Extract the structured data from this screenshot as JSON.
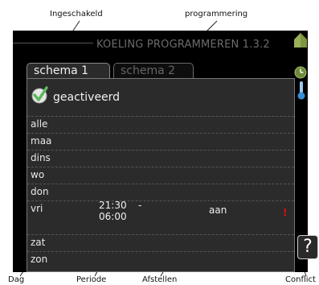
{
  "annotations": {
    "enabled": "Ingeschakeld",
    "programming": "programmering",
    "day": "Dag",
    "period": "Periode",
    "adjust": "Afstellen",
    "conflict": "Conflict"
  },
  "screen": {
    "title": "KOELING PROGRAMMEREN 1.3.2",
    "tabs": [
      {
        "label": "schema 1",
        "active": true
      },
      {
        "label": "schema 2",
        "active": false
      }
    ],
    "activated_label": "geactiveerd",
    "days": [
      "alle",
      "maa",
      "dins",
      "wo",
      "don",
      "vri",
      "zat",
      "zon"
    ],
    "entry": {
      "day": "vri",
      "period_start": "21:30",
      "period_separator": "-",
      "period_end": "06:00",
      "setting": "aan",
      "conflict_marker": "!"
    },
    "help_label": "?"
  },
  "icons": {
    "house": "house-icon",
    "clock": "clock-icon",
    "thermometer": "thermometer-icon",
    "check": "checkmark-icon",
    "help": "help-icon"
  },
  "colors": {
    "screen_bg": "#000000",
    "panel_bg": "#2b2b2b",
    "house": "#9ab05a",
    "thermometer": "#3a8fd6",
    "check": "#5cb85c",
    "conflict": "#e01010"
  }
}
